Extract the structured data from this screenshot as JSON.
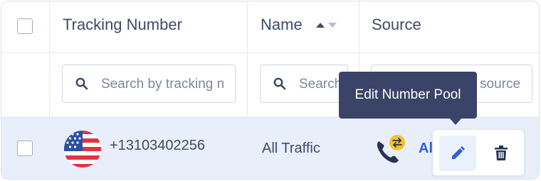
{
  "table": {
    "columns": {
      "tracking": "Tracking Number",
      "name": "Name",
      "source": "Source"
    },
    "filters": {
      "tracking_placeholder": "Search by tracking n",
      "name_placeholder": "Search",
      "source_placeholder": "source"
    },
    "rows": [
      {
        "country": "US",
        "tracking_number": "+13103402256",
        "name": "All Traffic",
        "source": "Al"
      }
    ]
  },
  "tooltip": {
    "text": "Edit Number Pool"
  },
  "colors": {
    "row_highlight": "#e8effb",
    "link": "#2f5fd8",
    "tooltip_bg": "#3a4468",
    "badge": "#f5c323"
  }
}
